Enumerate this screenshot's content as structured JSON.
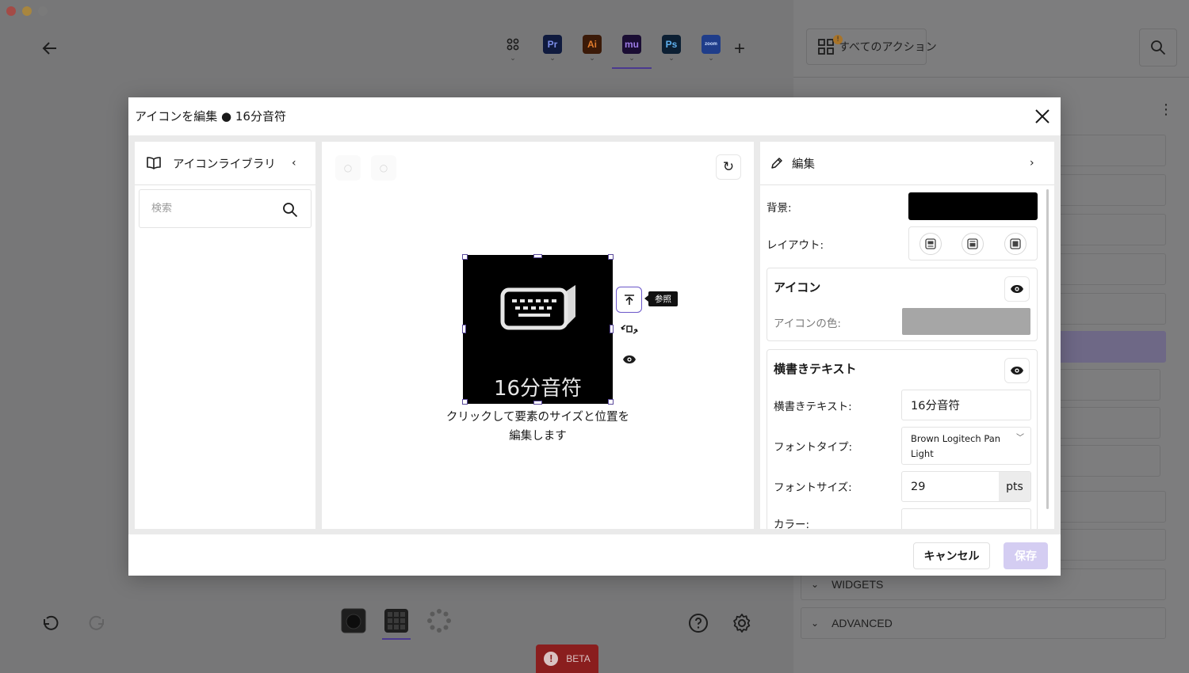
{
  "top_tabs": [
    {
      "name": "all-apps",
      "label": ""
    },
    {
      "name": "premiere",
      "label": "Pr"
    },
    {
      "name": "illustrator",
      "label": "Ai"
    },
    {
      "name": "mu",
      "label": "mu"
    },
    {
      "name": "photoshop",
      "label": "Ps"
    },
    {
      "name": "zoom",
      "label": "zoom"
    }
  ],
  "active_top_tab": "mu",
  "side_panel": {
    "all_actions_label": "すべてのアクション",
    "badge": "!",
    "sections": [
      "WIDGETS",
      "ADVANCED"
    ]
  },
  "beta_label": "BETA",
  "dialog": {
    "title": "アイコンを編集 ● 16分音符",
    "library": {
      "title": "アイコンライブラリ",
      "search_placeholder": "検索"
    },
    "canvas": {
      "preview_text": "16分音符",
      "tooltip": "参照",
      "hint": "クリックして要素のサイズと位置を編集します"
    },
    "edit": {
      "title": "編集",
      "background_label": "背景:",
      "layout_label": "レイアウト:",
      "icon_section_title": "アイコン",
      "icon_color_label": "アイコンの色:",
      "text_section_title": "横書きテキスト",
      "text_label": "横書きテキスト:",
      "text_value": "16分音符",
      "font_type_label": "フォントタイプ:",
      "font_type_value": "Brown Logitech Pan Light",
      "font_size_label": "フォントサイズ:",
      "font_size_value": "29",
      "font_size_unit": "pts",
      "color_label": "カラー:"
    },
    "footer": {
      "cancel_label": "キャンセル",
      "save_label": "保存"
    }
  },
  "colors": {
    "accent": "#6b57c9",
    "save_disabled": "#d4cdf2",
    "background_swatch": "#000000",
    "icon_color_swatch": "#a6a6a6",
    "beta": "#8a1e1e"
  }
}
